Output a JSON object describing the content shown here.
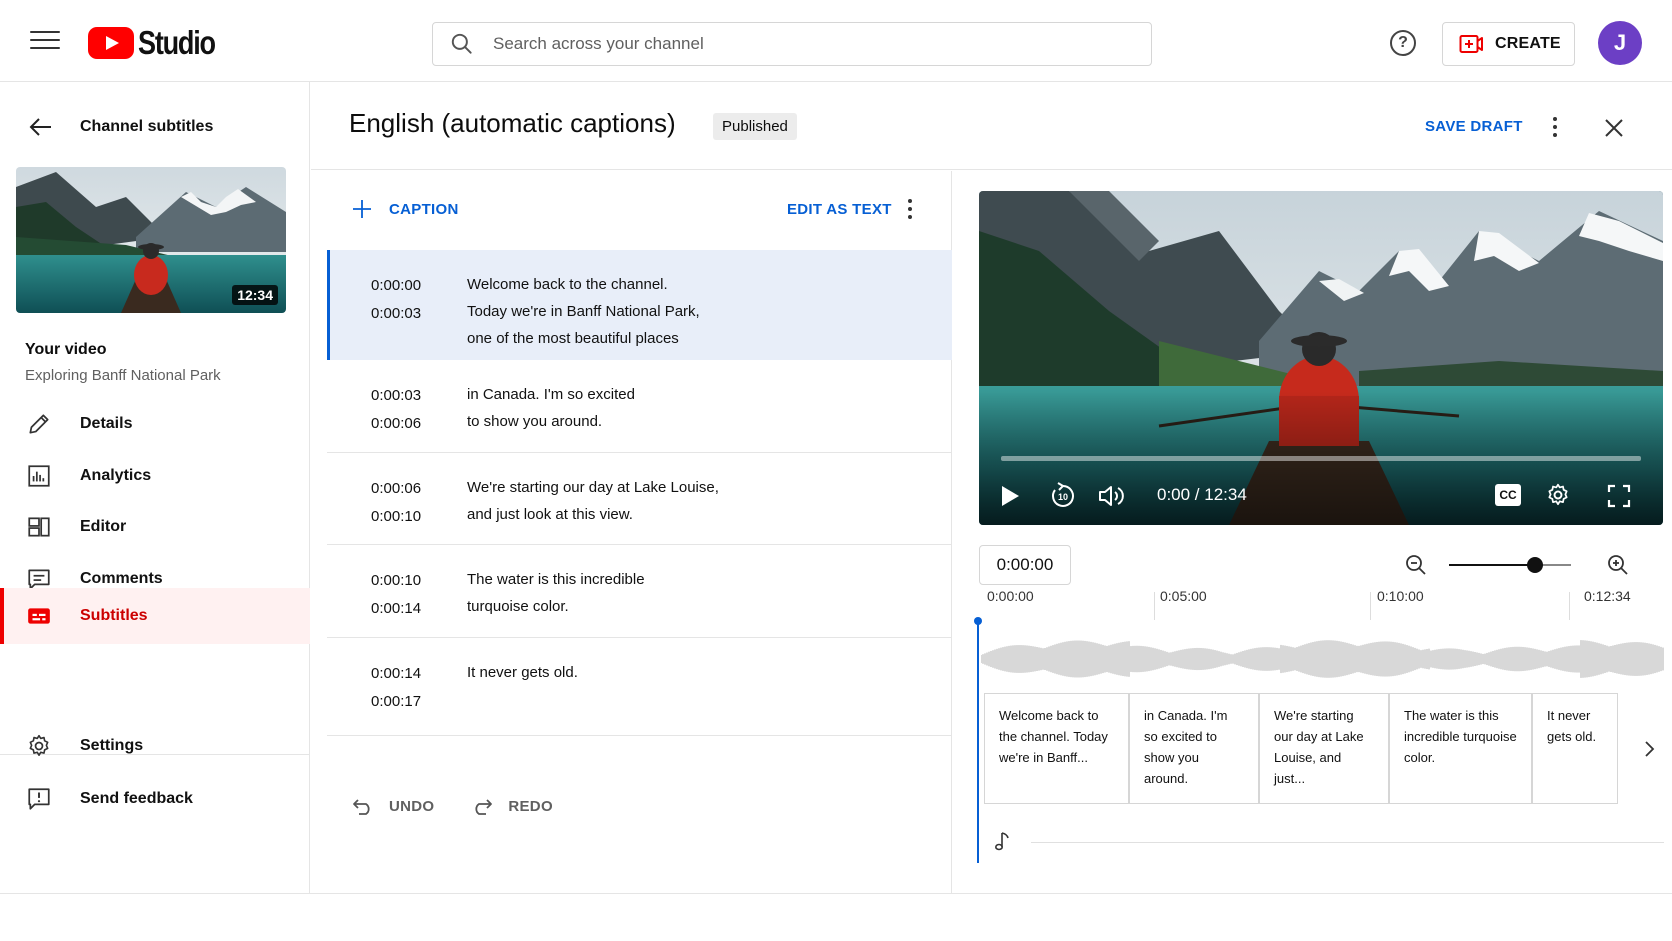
{
  "topbar": {
    "logo_text": "Studio",
    "search_placeholder": "Search across your channel",
    "create_label": "CREATE",
    "avatar_initial": "J"
  },
  "sidebar": {
    "back_title": "Channel subtitles",
    "thumbnail_duration": "12:34",
    "video_label": "Your video",
    "video_title": "Exploring Banff National Park",
    "nav": [
      {
        "label": "Details",
        "icon": "pencil-icon"
      },
      {
        "label": "Analytics",
        "icon": "analytics-icon"
      },
      {
        "label": "Editor",
        "icon": "editor-icon"
      },
      {
        "label": "Comments",
        "icon": "comments-icon"
      },
      {
        "label": "Subtitles",
        "icon": "subtitles-icon",
        "active": true
      }
    ],
    "bottom_nav": [
      {
        "label": "Settings",
        "icon": "gear-icon"
      },
      {
        "label": "Send feedback",
        "icon": "feedback-icon"
      }
    ]
  },
  "header": {
    "title": "English (automatic captions)",
    "status_badge": "Published",
    "save_draft_label": "SAVE DRAFT"
  },
  "captions_panel": {
    "add_caption_label": "CAPTION",
    "edit_as_text_label": "EDIT AS TEXT",
    "undo_label": "UNDO",
    "redo_label": "REDO",
    "rows": [
      {
        "start": "0:00:00",
        "end": "0:00:03",
        "text": "Welcome back to the channel.\nToday we're in Banff National Park,\none of the most beautiful places",
        "selected": true
      },
      {
        "start": "0:00:03",
        "end": "0:00:06",
        "text": "in Canada. I'm so excited\nto show you around."
      },
      {
        "start": "0:00:06",
        "end": "0:00:10",
        "text": "We're starting our day at Lake Louise,\nand just look at this view."
      },
      {
        "start": "0:00:10",
        "end": "0:00:14",
        "text": "The water is this incredible\nturquoise color."
      },
      {
        "start": "0:00:14",
        "end": "0:00:17",
        "text": "It never gets old."
      }
    ]
  },
  "player": {
    "time_display": "0:00 / 12:34",
    "cc_label": "CC",
    "skip_label": "10",
    "progress": 0
  },
  "timeline": {
    "timecode": "0:00:00",
    "ticks": [
      "0:00:00",
      "0:05:00",
      "0:10:00",
      "0:12:34"
    ],
    "zoom_level": 0.7,
    "blocks": [
      "Welcome back to the channel. Today we're in Banff...",
      "in Canada. I'm so excited to show you around.",
      "We're starting our day at Lake Louise, and just...",
      "The water is this incredible turquoise color.",
      "It never gets old."
    ]
  },
  "colors": {
    "accent_blue": "#065fd4",
    "brand_red": "#ff0000",
    "active_red": "#cc0000",
    "selected_row": "#e8eef9",
    "avatar": "#6c3fc5"
  }
}
